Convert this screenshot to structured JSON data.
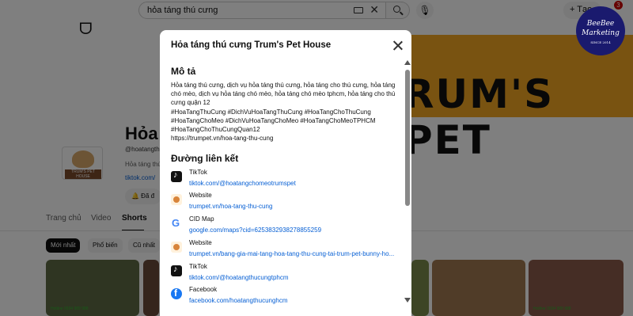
{
  "search": {
    "query": "hỏa táng thú cưng"
  },
  "header": {
    "create_label": "+ Tạo",
    "notification_count": "3"
  },
  "banner": {
    "text": "RUM'S PET"
  },
  "channel": {
    "title": "Hỏa t",
    "handle": "@hoatangth",
    "desc": "Hỏa táng thú",
    "link": "tiktok.com/",
    "subscribed_label": "🔔 Đã đ",
    "avatar_label": "TRUM'S PET HOUSE"
  },
  "tabs": [
    {
      "label": "Trang chủ"
    },
    {
      "label": "Video"
    },
    {
      "label": "Shorts"
    }
  ],
  "chips": [
    {
      "label": "Mới nhất"
    },
    {
      "label": "Phổ biến"
    },
    {
      "label": "Cũ nhất"
    }
  ],
  "thumbs": [
    {
      "caption": "Hotline 0934 989 988"
    },
    {
      "caption": "Hotline 0934 989 988"
    }
  ],
  "brand": {
    "line1": "BeeBee",
    "line2": "Marketing",
    "line3": "SINCE 2014"
  },
  "modal": {
    "title": "Hỏa táng thú cưng Trum's Pet House",
    "description_heading": "Mô tả",
    "description": "Hỏa táng thú cưng, dịch vụ hỏa táng thú cưng, hỏa táng cho thú cưng, hỏa táng chó mèo, dịch vụ hỏa táng chó mèo,  hỏa táng chó mèo tphcm, hỏa táng cho thú cưng quận 12\n#HoaTangThuCung #DichVuHoaTangThuCung #HoaTangChoThuCung\n#HoaTangChoMeo #DichVuHoaTangChoMeo #HoaTangChoMeoTPHCM\n#HoaTangChoThuCungQuan12\nhttps://trumpet.vn/hoa-tang-thu-cung",
    "links_heading": "Đường liên kết",
    "links": [
      {
        "icon": "tiktok-icon",
        "name": "TikTok",
        "url": "tiktok.com/@hoatangchomeotrumspet"
      },
      {
        "icon": "website-icon",
        "name": "Website",
        "url": "trumpet.vn/hoa-tang-thu-cung"
      },
      {
        "icon": "google-icon",
        "name": "CID Map",
        "url": "google.com/maps?cid=6253832938278855259"
      },
      {
        "icon": "website-icon",
        "name": "Website",
        "url": "trumpet.vn/bang-gia-mai-tang-hoa-tang-thu-cung-tai-trum-pet-bunny-ho..."
      },
      {
        "icon": "tiktok-icon",
        "name": "TikTok",
        "url": "tiktok.com/@hoatangthucungtphcm"
      },
      {
        "icon": "facebook-icon",
        "name": "Facebook",
        "url": "facebook.com/hoatangthucunghcm"
      }
    ]
  }
}
